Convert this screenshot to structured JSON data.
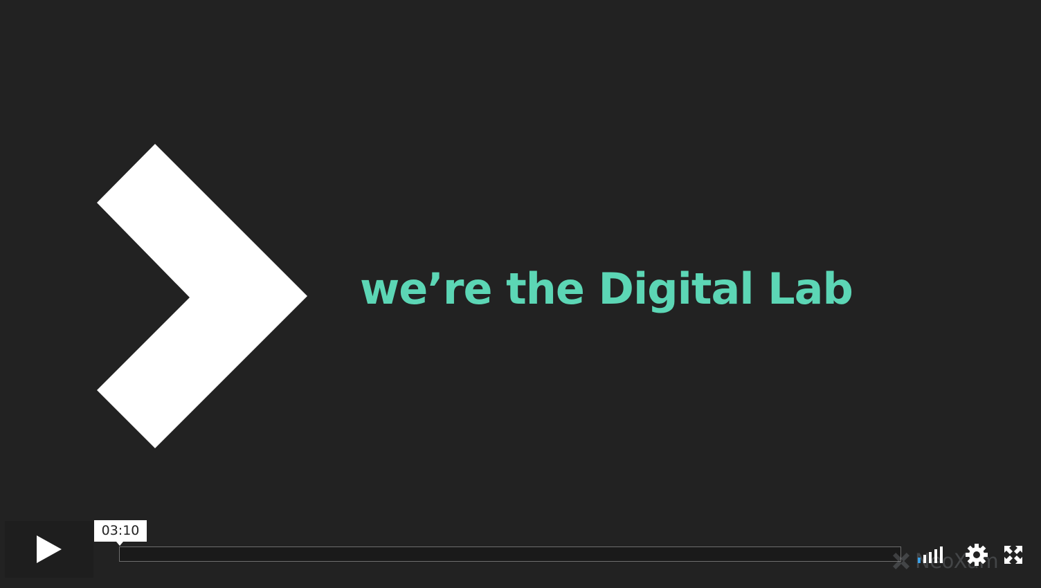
{
  "video": {
    "headline": "we’re the Digital Lab",
    "accent_color": "#5cd6b5",
    "background_color": "#222222"
  },
  "controls": {
    "play_icon": "play-icon",
    "time_tooltip": "03:10",
    "progress_fraction": 0,
    "volume_icon": "volume-bars-icon",
    "settings_icon": "gear-icon",
    "fullscreen_icon": "fullscreen-icon"
  },
  "watermark": {
    "text": "NeoXam",
    "icon": "neoxam-logo-icon"
  }
}
